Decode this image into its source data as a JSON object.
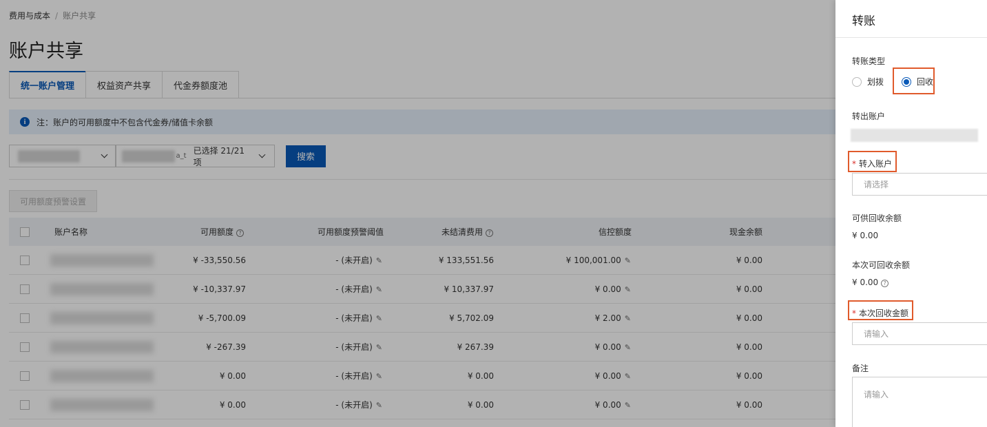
{
  "breadcrumb": {
    "parent": "费用与成本",
    "separator": "/",
    "current": "账户共享"
  },
  "page_title": "账户共享",
  "tabs": [
    {
      "label": "统一账户管理",
      "active": true
    },
    {
      "label": "权益资产共享",
      "active": false
    },
    {
      "label": "代金券额度池",
      "active": false
    }
  ],
  "notice": {
    "icon": "info-icon",
    "text": "注：账户的可用额度中不包含代金券/储值卡余额"
  },
  "filters": {
    "select2_suffix": "a_t",
    "selected_text": "已选择 21/21 项",
    "search_label": "搜索"
  },
  "warn_button_label": "可用额度预警设置",
  "table": {
    "headers": {
      "name": "账户名称",
      "available": "可用额度",
      "threshold": "可用额度预警阈值",
      "unsettled": "未结清费用",
      "credit": "信控额度",
      "cash": "现金余额"
    },
    "rows": [
      {
        "available": "¥ -33,550.56",
        "threshold": "- (未开启)",
        "unsettled": "¥ 133,551.56",
        "credit": "¥ 100,001.00",
        "cash": "¥ 0.00"
      },
      {
        "available": "¥ -10,337.97",
        "threshold": "- (未开启)",
        "unsettled": "¥ 10,337.97",
        "credit": "¥ 0.00",
        "cash": "¥ 0.00"
      },
      {
        "available": "¥ -5,700.09",
        "threshold": "- (未开启)",
        "unsettled": "¥ 5,702.09",
        "credit": "¥ 2.00",
        "cash": "¥ 0.00"
      },
      {
        "available": "¥ -267.39",
        "threshold": "- (未开启)",
        "unsettled": "¥ 267.39",
        "credit": "¥ 0.00",
        "cash": "¥ 0.00"
      },
      {
        "available": "¥ 0.00",
        "threshold": "- (未开启)",
        "unsettled": "¥ 0.00",
        "credit": "¥ 0.00",
        "cash": "¥ 0.00"
      },
      {
        "available": "¥ 0.00",
        "threshold": "- (未开启)",
        "unsettled": "¥ 0.00",
        "credit": "¥ 0.00",
        "cash": "¥ 0.00"
      }
    ]
  },
  "drawer": {
    "title": "转账",
    "transfer_type_label": "转账类型",
    "option_allocate": "划拨",
    "option_recover": "回收",
    "selected_option": "回收",
    "out_account_label": "转出账户",
    "in_account_label": "转入账户",
    "in_account_placeholder": "请选择",
    "recoverable_label": "可供回收余额",
    "recoverable_value": "¥ 0.00",
    "this_recoverable_label": "本次可回收余额",
    "this_recoverable_value": "¥ 0.00",
    "recover_amount_label": "本次回收金额",
    "recover_amount_placeholder": "请输入",
    "remark_label": "备注",
    "remark_placeholder": "请输入",
    "required_mark": "*",
    "highlight_color": "#e05a2b"
  },
  "colors": {
    "primary": "#0a5ab8",
    "notice_bg": "#e6f0fb",
    "required": "#d9302c"
  }
}
